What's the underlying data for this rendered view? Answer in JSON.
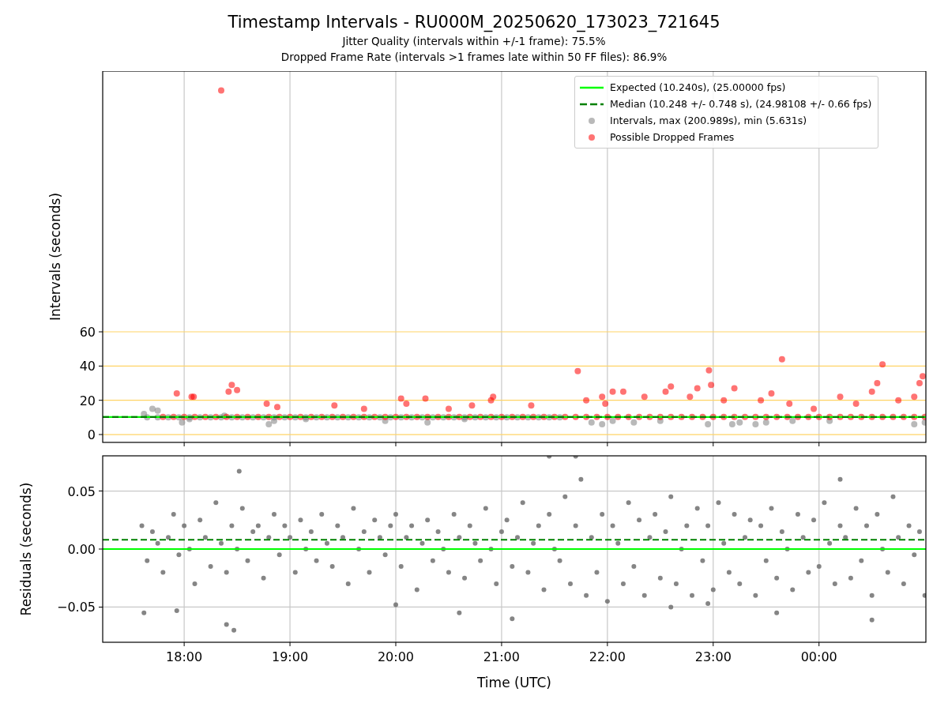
{
  "title": "Timestamp Intervals - RU000M_20250620_173023_721645",
  "subtitles": [
    "Jitter Quality (intervals within +/-1 frame): 75.5%",
    "Dropped Frame Rate (intervals >1 frames late within 50 FF files): 86.9%"
  ],
  "intervals_chart": {
    "chart_data": {
      "type": "scatter",
      "ylabel": "Intervals (seconds)",
      "grid": true,
      "xlim": [
        17.23,
        25.01
      ],
      "ylim": [
        -4.6,
        212.3
      ],
      "yticks": [
        {
          "value": 0,
          "label": "0"
        },
        {
          "value": 20,
          "label": "20"
        },
        {
          "value": 40,
          "label": "40"
        },
        {
          "value": 60,
          "label": "60"
        }
      ],
      "series": [
        {
          "name": "Expected (10.240s), (25.00000 fps)",
          "type": "line",
          "line_style": "solid",
          "color": "#00ff00",
          "x": [
            17.23,
            25.01
          ],
          "values": [
            10.24,
            10.24
          ]
        },
        {
          "name": "Median (10.248 +/- 0.748 s), (24.98108 +/- 0.66 fps)",
          "type": "line",
          "line_style": "dashed",
          "color": "#008000",
          "x": [
            17.23,
            25.01
          ],
          "values": [
            10.248,
            10.248
          ]
        },
        {
          "name": "Intervals, max (200.989s), min (5.631s)",
          "type": "scatter",
          "color": "#808080",
          "x": [
            17.65,
            17.75,
            17.85,
            17.95,
            18.05,
            18.15,
            18.25,
            18.35,
            18.45,
            18.55,
            18.65,
            18.75,
            18.85,
            18.95,
            19.05,
            19.15,
            19.25,
            19.35,
            19.45,
            19.55,
            19.65,
            19.75,
            19.85,
            19.95,
            20.05,
            20.15,
            20.25,
            20.35,
            20.45,
            20.55,
            20.65,
            20.75,
            20.85,
            20.95,
            21.05,
            21.15,
            21.25,
            21.35,
            21.45,
            21.55,
            17.62,
            17.7,
            17.75,
            17.98,
            18.05,
            18.38,
            18.8,
            18.85,
            19.15,
            19.9,
            20.3,
            20.65,
            21.85,
            21.95,
            22.05,
            22.25,
            22.5,
            22.95,
            23.18,
            23.25,
            23.4,
            23.5,
            23.75,
            24.1,
            24.9,
            25.0
          ],
          "values": [
            10,
            10,
            10,
            10,
            10,
            10,
            10,
            10,
            10,
            10,
            10,
            10,
            10,
            10,
            10,
            10,
            10,
            10,
            10,
            10,
            10,
            10,
            10,
            10,
            10,
            10,
            10,
            10,
            10,
            10,
            10,
            10,
            10,
            10,
            10,
            10,
            10,
            10,
            10,
            10,
            12,
            15,
            14,
            7,
            9,
            11,
            6,
            8,
            9,
            8,
            7,
            9,
            7,
            6,
            8,
            7,
            8,
            6,
            6,
            7,
            6,
            7,
            8,
            8,
            6,
            7
          ]
        },
        {
          "name": "Possible Dropped Frames",
          "type": "scatter",
          "color": "#ff0000",
          "x": [
            17.8,
            17.9,
            18.0,
            18.1,
            18.2,
            18.3,
            18.4,
            18.5,
            18.6,
            18.7,
            18.8,
            18.9,
            19.0,
            19.1,
            19.2,
            19.3,
            19.4,
            19.5,
            19.6,
            19.7,
            19.8,
            19.9,
            20.0,
            20.1,
            20.2,
            20.3,
            20.4,
            20.5,
            20.6,
            20.7,
            20.8,
            20.9,
            21.0,
            21.1,
            21.2,
            21.3,
            21.4,
            21.5,
            21.6,
            21.7,
            21.8,
            21.9,
            22.0,
            22.1,
            22.2,
            22.3,
            22.4,
            22.5,
            22.6,
            22.7,
            22.8,
            22.9,
            23.0,
            23.1,
            23.2,
            23.3,
            23.4,
            23.5,
            23.6,
            23.7,
            23.8,
            23.9,
            24.0,
            24.1,
            24.2,
            24.3,
            24.4,
            24.5,
            24.6,
            24.7,
            24.8,
            24.9,
            25.0,
            18.35,
            17.93,
            18.07,
            18.09,
            18.42,
            18.45,
            18.5,
            18.78,
            18.88,
            19.42,
            19.7,
            20.05,
            20.1,
            20.28,
            20.5,
            20.72,
            20.92,
            20.9,
            21.28,
            21.72,
            21.8,
            21.95,
            21.98,
            22.05,
            22.15,
            22.35,
            22.55,
            22.6,
            22.78,
            22.85,
            22.96,
            22.98,
            23.1,
            23.2,
            23.45,
            23.55,
            23.65,
            23.72,
            23.95,
            24.2,
            24.35,
            24.5,
            24.55,
            24.6,
            24.75,
            24.9,
            24.98,
            24.95
          ],
          "values": [
            10.3,
            10.3,
            10.3,
            10.3,
            10.3,
            10.3,
            10.3,
            10.3,
            10.3,
            10.3,
            10.3,
            10.3,
            10.3,
            10.3,
            10.3,
            10.3,
            10.3,
            10.3,
            10.3,
            10.3,
            10.3,
            10.3,
            10.3,
            10.3,
            10.3,
            10.3,
            10.3,
            10.3,
            10.3,
            10.3,
            10.3,
            10.3,
            10.3,
            10.3,
            10.3,
            10.3,
            10.3,
            10.3,
            10.3,
            10.3,
            10.3,
            10.3,
            10.3,
            10.3,
            10.3,
            10.3,
            10.3,
            10.3,
            10.3,
            10.3,
            10.3,
            10.3,
            10.3,
            10.3,
            10.3,
            10.3,
            10.3,
            10.3,
            10.3,
            10.3,
            10.3,
            10.3,
            10.3,
            10.3,
            10.3,
            10.3,
            10.3,
            10.3,
            10.3,
            10.3,
            10.3,
            10.3,
            10.3,
            200.989,
            24,
            22,
            22,
            25,
            29,
            26,
            18,
            16,
            17,
            15,
            21,
            18,
            21,
            15,
            17,
            22,
            20,
            17,
            37,
            20,
            22,
            18,
            25,
            25,
            22,
            25,
            28,
            22,
            27,
            37.5,
            29,
            20,
            27,
            20,
            24,
            44,
            18,
            15,
            22,
            18,
            25,
            30,
            41,
            20,
            22,
            34,
            30
          ]
        }
      ]
    }
  },
  "residuals_chart": {
    "chart_data": {
      "type": "scatter",
      "xlabel": "Time (UTC)",
      "ylabel": "Residuals (seconds)",
      "grid": true,
      "xlim": [
        17.23,
        25.01
      ],
      "ylim": [
        -0.0803,
        0.0803
      ],
      "xticks": [
        {
          "value": 18,
          "label": "18:00"
        },
        {
          "value": 19,
          "label": "19:00"
        },
        {
          "value": 20,
          "label": "20:00"
        },
        {
          "value": 21,
          "label": "21:00"
        },
        {
          "value": 22,
          "label": "22:00"
        },
        {
          "value": 23,
          "label": "23:00"
        },
        {
          "value": 24,
          "label": "00:00"
        }
      ],
      "yticks": [
        {
          "value": -0.05,
          "label": "−0.05"
        },
        {
          "value": 0,
          "label": "0.00"
        },
        {
          "value": 0.05,
          "label": "0.05"
        }
      ],
      "series": [
        {
          "type": "line",
          "line_style": "solid",
          "color": "#00ff00",
          "x": [
            17.23,
            25.01
          ],
          "values": [
            0,
            0
          ]
        },
        {
          "type": "line",
          "line_style": "dashed",
          "color": "#008000",
          "x": [
            17.23,
            25.01
          ],
          "values": [
            0.008,
            0.008
          ]
        },
        {
          "type": "scatter",
          "color": "#707070",
          "x": [
            17.6,
            17.65,
            17.7,
            17.75,
            17.8,
            17.85,
            17.9,
            17.95,
            18.0,
            18.05,
            18.1,
            18.15,
            18.2,
            18.25,
            18.3,
            18.35,
            18.4,
            18.45,
            18.5,
            18.55,
            18.6,
            18.65,
            18.7,
            18.75,
            18.8,
            18.85,
            18.9,
            18.95,
            19.0,
            19.05,
            19.1,
            19.15,
            19.2,
            19.25,
            19.3,
            19.35,
            19.4,
            19.45,
            19.5,
            19.55,
            19.6,
            19.65,
            19.7,
            19.75,
            19.8,
            19.85,
            19.9,
            19.95,
            20.0,
            20.05,
            20.1,
            20.15,
            20.2,
            20.25,
            20.3,
            20.35,
            20.4,
            20.45,
            20.5,
            20.55,
            20.6,
            20.65,
            20.7,
            20.75,
            20.8,
            20.85,
            20.9,
            20.95,
            21.0,
            21.05,
            21.1,
            21.15,
            21.2,
            21.25,
            21.3,
            21.35,
            21.4,
            21.45,
            21.5,
            21.55,
            21.6,
            21.65,
            21.7,
            21.75,
            21.8,
            21.85,
            21.9,
            21.95,
            22.0,
            22.05,
            22.1,
            22.15,
            22.2,
            22.25,
            22.3,
            22.35,
            22.4,
            22.45,
            22.5,
            22.55,
            22.6,
            22.65,
            22.7,
            22.75,
            22.8,
            22.85,
            22.9,
            22.95,
            23.0,
            23.05,
            23.1,
            23.15,
            23.2,
            23.25,
            23.3,
            23.35,
            23.4,
            23.45,
            23.5,
            23.55,
            23.6,
            23.65,
            23.7,
            23.75,
            23.8,
            23.85,
            23.9,
            23.95,
            24.0,
            24.05,
            24.1,
            24.15,
            24.2,
            24.25,
            24.3,
            24.35,
            24.4,
            24.45,
            24.5,
            24.55,
            24.6,
            24.65,
            24.7,
            24.75,
            24.8,
            24.85,
            24.9,
            24.95,
            25.0,
            17.62,
            17.93,
            18.4,
            18.52,
            18.47,
            20.0,
            20.6,
            21.1,
            21.45,
            21.7,
            22.6,
            22.95,
            23.6,
            24.2,
            24.5
          ],
          "values": [
            0.02,
            -0.01,
            0.015,
            0.005,
            -0.02,
            0.01,
            0.03,
            -0.005,
            0.02,
            0.0,
            -0.03,
            0.025,
            0.01,
            -0.015,
            0.04,
            0.005,
            -0.02,
            0.02,
            0.0,
            0.035,
            -0.01,
            0.015,
            0.02,
            -0.025,
            0.01,
            0.03,
            -0.005,
            0.02,
            0.01,
            -0.02,
            0.025,
            0.0,
            0.015,
            -0.01,
            0.03,
            0.005,
            -0.015,
            0.02,
            0.01,
            -0.03,
            0.035,
            0.0,
            0.015,
            -0.02,
            0.025,
            0.01,
            -0.005,
            0.02,
            0.03,
            -0.015,
            0.01,
            0.02,
            -0.035,
            0.005,
            0.025,
            -0.01,
            0.015,
            0.0,
            -0.02,
            0.03,
            0.01,
            -0.025,
            0.02,
            0.005,
            -0.01,
            0.035,
            0.0,
            -0.03,
            0.015,
            0.025,
            -0.015,
            0.01,
            0.04,
            -0.02,
            0.005,
            0.02,
            -0.035,
            0.03,
            0.0,
            -0.01,
            0.045,
            -0.03,
            0.02,
            0.06,
            -0.04,
            0.01,
            -0.02,
            0.03,
            -0.045,
            0.02,
            0.005,
            -0.03,
            0.04,
            -0.015,
            0.025,
            -0.04,
            0.01,
            0.03,
            -0.025,
            0.015,
            0.045,
            -0.03,
            0.0,
            0.02,
            -0.04,
            0.035,
            -0.01,
            0.02,
            -0.035,
            0.04,
            0.005,
            -0.02,
            0.03,
            -0.03,
            0.01,
            0.025,
            -0.04,
            0.02,
            -0.01,
            0.035,
            -0.025,
            0.015,
            0.0,
            -0.035,
            0.03,
            0.01,
            -0.02,
            0.025,
            -0.015,
            0.04,
            0.005,
            -0.03,
            0.02,
            0.01,
            -0.025,
            0.035,
            -0.01,
            0.02,
            -0.04,
            0.03,
            0.0,
            -0.02,
            0.045,
            0.01,
            -0.03,
            0.02,
            -0.005,
            0.015,
            -0.04,
            -0.055,
            -0.053,
            -0.065,
            0.067,
            -0.07,
            -0.048,
            -0.055,
            -0.06,
            0.08,
            0.08,
            -0.05,
            -0.047,
            -0.055,
            0.06,
            -0.061
          ]
        }
      ]
    }
  }
}
